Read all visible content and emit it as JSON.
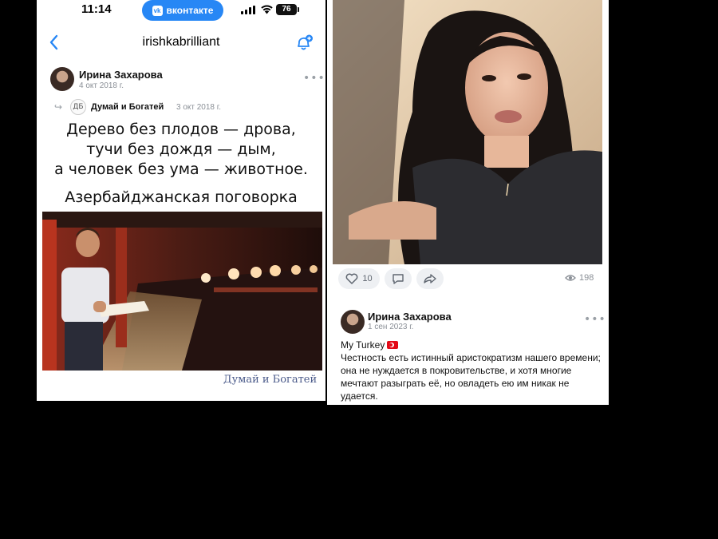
{
  "left_screen": {
    "status_bar": {
      "time": "11:14",
      "app_pill": "вконтакте",
      "battery": "76"
    },
    "nav": {
      "title": "irishkabrilliant",
      "accent_color": "#2787f5"
    },
    "post": {
      "author": "Ирина Захарова",
      "date": "4 окт 2018 г.",
      "repost": {
        "group_name": "Думай и Богатей",
        "group_date": "3 окт 2018 г."
      },
      "quote_lines": [
        "Дерево без плодов — дрова,",
        "тучи без дождя — дым,",
        "а человек без ума — животное."
      ],
      "quote_source": "Азербайджанская поговорка",
      "watermark": "Думай и Богатей"
    }
  },
  "right_screen": {
    "post_actions": {
      "likes": "10",
      "views": "198"
    },
    "post": {
      "author": "Ирина Захарова",
      "date": "1 сен 2023 г.",
      "caption_title": "My Turkey",
      "caption_body": "Честность есть истинный аристократизм нашего времени; она не нуждается в покровительстве, и хотя многие мечтают разыграть её, но овладеть ею им никак не удается."
    }
  }
}
